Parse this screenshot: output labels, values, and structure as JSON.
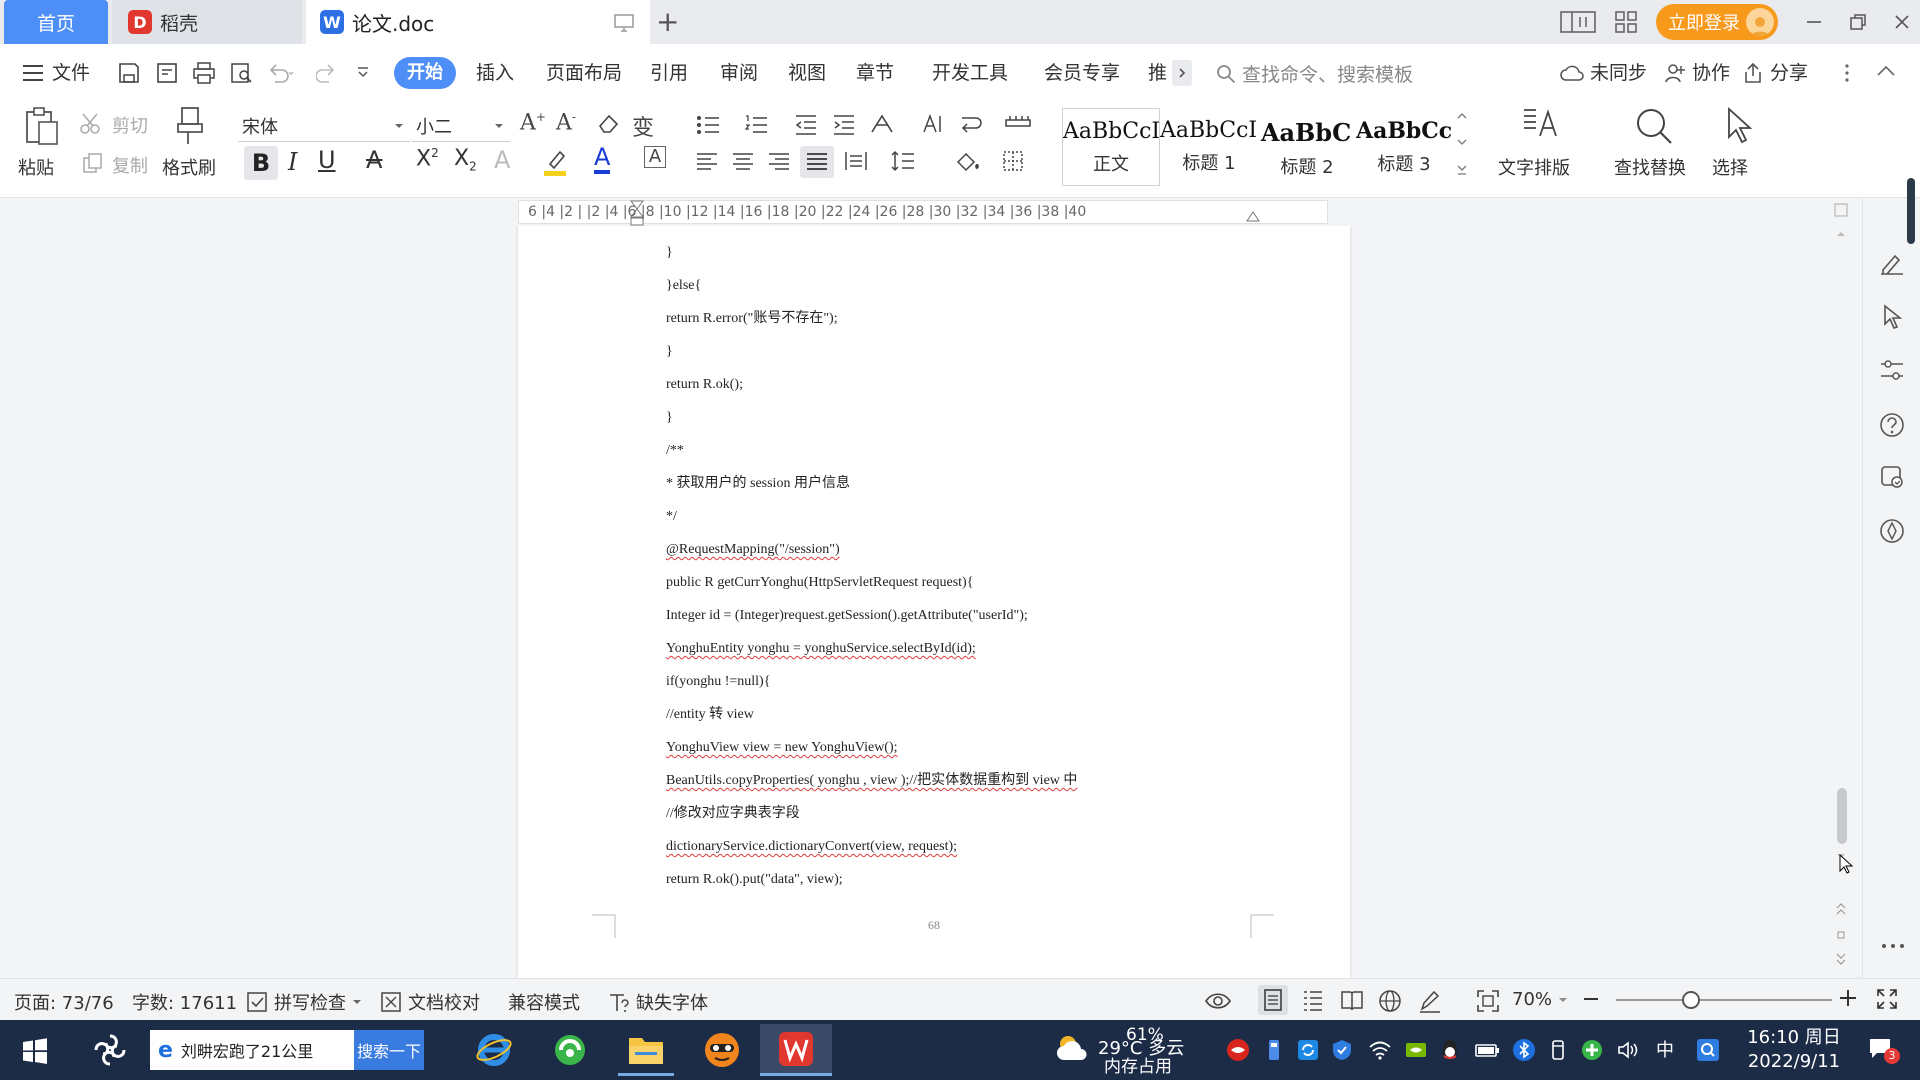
{
  "titlebar": {
    "tabs": [
      {
        "label": "首页"
      },
      {
        "label": "稻壳"
      },
      {
        "label": "论文.doc"
      }
    ],
    "login_label": "立即登录"
  },
  "menu": {
    "file": "文件",
    "items": [
      "开始",
      "插入",
      "页面布局",
      "引用",
      "审阅",
      "视图",
      "章节",
      "开发工具",
      "会员专享",
      "推"
    ],
    "search_placeholder": "查找命令、搜索模板",
    "sync": "未同步",
    "collab": "协作",
    "share": "分享"
  },
  "ribbon": {
    "paste": "粘贴",
    "cut": "剪切",
    "copy": "复制",
    "format_painter": "格式刷",
    "font_name": "宋体",
    "font_size": "小二",
    "styles": [
      {
        "sample": "AaBbCcI",
        "name": "正文"
      },
      {
        "sample": "AaBbCcI",
        "name": "标题 1"
      },
      {
        "sample": "AaBbC",
        "name": "标题 2"
      },
      {
        "sample": "AaBbCcl",
        "name": "标题 3"
      }
    ],
    "text_layout": "文字排版",
    "find_replace": "查找替换",
    "select": "选择"
  },
  "ruler": {
    "marks": "6  |4  |2  |     |2  |4  |6  |8  |10 |12 |14 |16 |18 |20 |22 |24 |26 |28 |30 |32 |34 |36 |38 |40"
  },
  "document": {
    "lines": [
      "}",
      "}else{",
      "return R.error(\"账号不存在\");",
      "}",
      "return R.ok();",
      "}",
      "/**",
      "* 获取用户的 session 用户信息",
      "*/",
      "@RequestMapping(\"/session\")",
      "public R getCurrYonghu(HttpServletRequest request){",
      "Integer id = (Integer)request.getSession().getAttribute(\"userId\");",
      "YonghuEntity yonghu = yonghuService.selectById(id);",
      "if(yonghu !=null){",
      "//entity 转 view",
      "YonghuView view = new YonghuView();",
      "BeanUtils.copyProperties( yonghu , view );//把实体数据重构到 view 中",
      "//修改对应字典表字段",
      "dictionaryService.dictionaryConvert(view, request);",
      "return R.ok().put(\"data\", view);"
    ],
    "page_number": "68"
  },
  "statusbar": {
    "page": "页面: 73/76",
    "words": "字数: 17611",
    "spell": "拼写检查",
    "proof": "文档校对",
    "compat": "兼容模式",
    "missing_font": "缺失字体",
    "zoom": "70%",
    "zoom_level": 0.7
  },
  "taskbar": {
    "search_text": "刘畊宏跑了21公里",
    "search_button": "搜索一下",
    "weather_temp": "29°C 多云",
    "memory": "61%",
    "memory_label": "内存占用",
    "ime": "中",
    "time": "16:10 周日",
    "date": "2022/9/11",
    "notify_count": "3"
  },
  "colors": {
    "accent": "#4e8ef7",
    "login": "#f79a1c",
    "taskbar": "#1c2b46",
    "spell_error": "#e03b3b"
  }
}
